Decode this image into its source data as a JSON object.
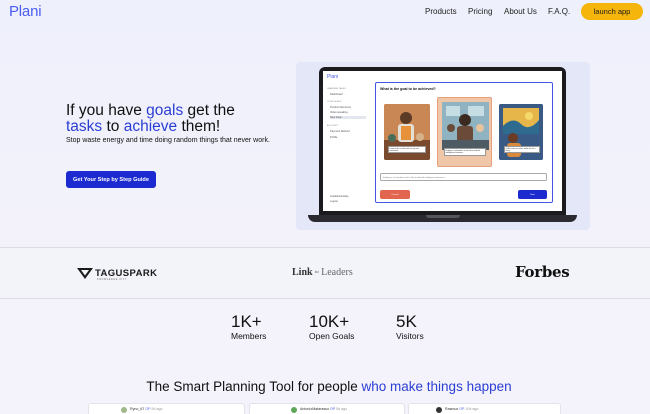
{
  "nav": {
    "logo": "Plani",
    "links": [
      "Products",
      "Pricing",
      "About Us",
      "F.A.Q."
    ],
    "cta": "launch app"
  },
  "hero": {
    "title": {
      "part1": "If you have ",
      "goals": "goals",
      "part2": " get the",
      "tasks": "tasks",
      "part3": " to ",
      "achieve": "achieve",
      "part4": " them!"
    },
    "subtitle": "Stop waste energy and time doing random things that never work.",
    "button": "Get Your Step by Step Guide"
  },
  "app_preview": {
    "logo": "Plani",
    "sidebar": {
      "section1": "LEARNING TASKS",
      "dashboard": "Dashboard",
      "section2": "YOUR GOALS",
      "goal1": "Product Discovery",
      "goal2": "Video speaking",
      "goal3": "New Goal",
      "section3": "ACCOUNT",
      "account1": "Payment Method",
      "account2": "Profile",
      "footer1": "Guidelines/Help",
      "footer2": "Logout"
    },
    "question": "What is the goal to be achieved?",
    "card_captions": [
      "I want to be a chef and run my own restaurant",
      "Finding a co-founder to kick-off a artificial intelligence business",
      "I'd like to be an artist, make art for a living"
    ],
    "input_value": "Finding a co-founder to kick-off an artificial intelligence business",
    "cancel": "Cancel",
    "next": "Next"
  },
  "press": {
    "tagus": "TAGUSPARK",
    "tagus_sub": "KNOWLEDGE CITY",
    "link_leaders": {
      "a": "Link ",
      "to": "to",
      "b": " Leaders"
    },
    "forbes": "Forbes"
  },
  "stats": [
    {
      "value": "1K+",
      "label": "Members"
    },
    {
      "value": "10K+",
      "label": "Open Goals"
    },
    {
      "value": "5K",
      "label": "Visitors"
    }
  ],
  "bottom": {
    "title_a": "The Smart Planning Tool for people ",
    "title_b": "who make things happen"
  },
  "testimonials": [
    {
      "user": "Ryno_67",
      "op": "OP",
      "ago": "5d ago"
    },
    {
      "user": "AntonioMatarasso",
      "op": "OP",
      "ago": "5d ago"
    },
    {
      "user": "Rasmus",
      "op": "OP",
      "ago": "10d ago"
    }
  ],
  "colors": {
    "brand": "#2b3ed4",
    "cta": "#f5b50a",
    "button": "#1b2bd0"
  }
}
